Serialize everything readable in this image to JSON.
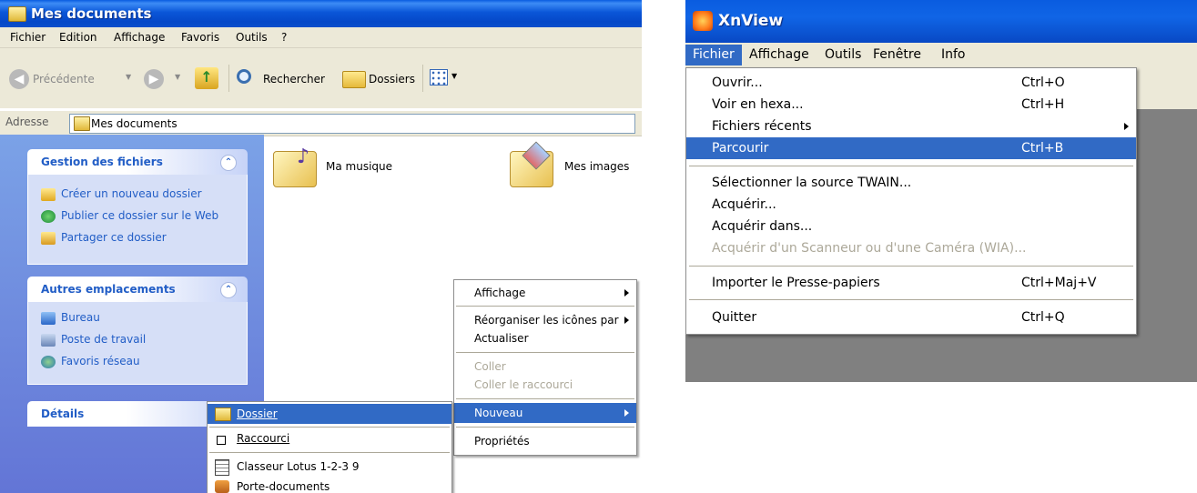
{
  "explorer": {
    "title": "Mes documents",
    "menu": [
      "Fichier",
      "Edition",
      "Affichage",
      "Favoris",
      "Outils",
      "?"
    ],
    "toolbar": {
      "back": "Précédente",
      "search": "Rechercher",
      "folders": "Dossiers"
    },
    "address": {
      "label": "Adresse",
      "value": "Mes documents"
    },
    "panels": {
      "file_tasks": {
        "title": "Gestion des fichiers",
        "items": [
          "Créer un nouveau dossier",
          "Publier ce dossier sur le Web",
          "Partager ce dossier"
        ]
      },
      "other_places": {
        "title": "Autres emplacements",
        "items": [
          "Bureau",
          "Poste de travail",
          "Favoris réseau"
        ]
      },
      "details": {
        "title": "Détails"
      }
    },
    "folders": [
      "Ma musique",
      "Mes images"
    ],
    "context_menu": {
      "items": [
        "Affichage",
        "Réorganiser les icônes par",
        "Actualiser",
        "Coller",
        "Coller le raccourci",
        "Nouveau",
        "Propriétés"
      ]
    },
    "new_submenu": {
      "items": [
        "Dossier",
        "Raccourci",
        "Classeur Lotus 1-2-3 9",
        "Porte-documents"
      ]
    }
  },
  "xnview": {
    "title": "XnView",
    "menu": [
      "Fichier",
      "Affichage",
      "Outils",
      "Fenêtre",
      "Info"
    ],
    "file_menu": [
      {
        "label": "Ouvrir...",
        "shortcut": "Ctrl+O"
      },
      {
        "label": "Voir en hexa...",
        "shortcut": "Ctrl+H"
      },
      {
        "label": "Fichiers récents",
        "shortcut": ""
      },
      {
        "label": "Parcourir",
        "shortcut": "Ctrl+B"
      },
      {
        "label": "Sélectionner la source TWAIN...",
        "shortcut": ""
      },
      {
        "label": "Acquérir...",
        "shortcut": ""
      },
      {
        "label": "Acquérir dans...",
        "shortcut": ""
      },
      {
        "label": "Acquérir d'un Scanneur ou d'une Caméra (WIA)...",
        "shortcut": ""
      },
      {
        "label": "Importer le Presse-papiers",
        "shortcut": "Ctrl+Maj+V"
      },
      {
        "label": "Quitter",
        "shortcut": "Ctrl+Q"
      }
    ]
  },
  "colors": {
    "xp_blue": "#0a56d8",
    "selection": "#316ac5",
    "taskpane": "#6f8ee0",
    "menu_bg": "#ece9d8"
  }
}
